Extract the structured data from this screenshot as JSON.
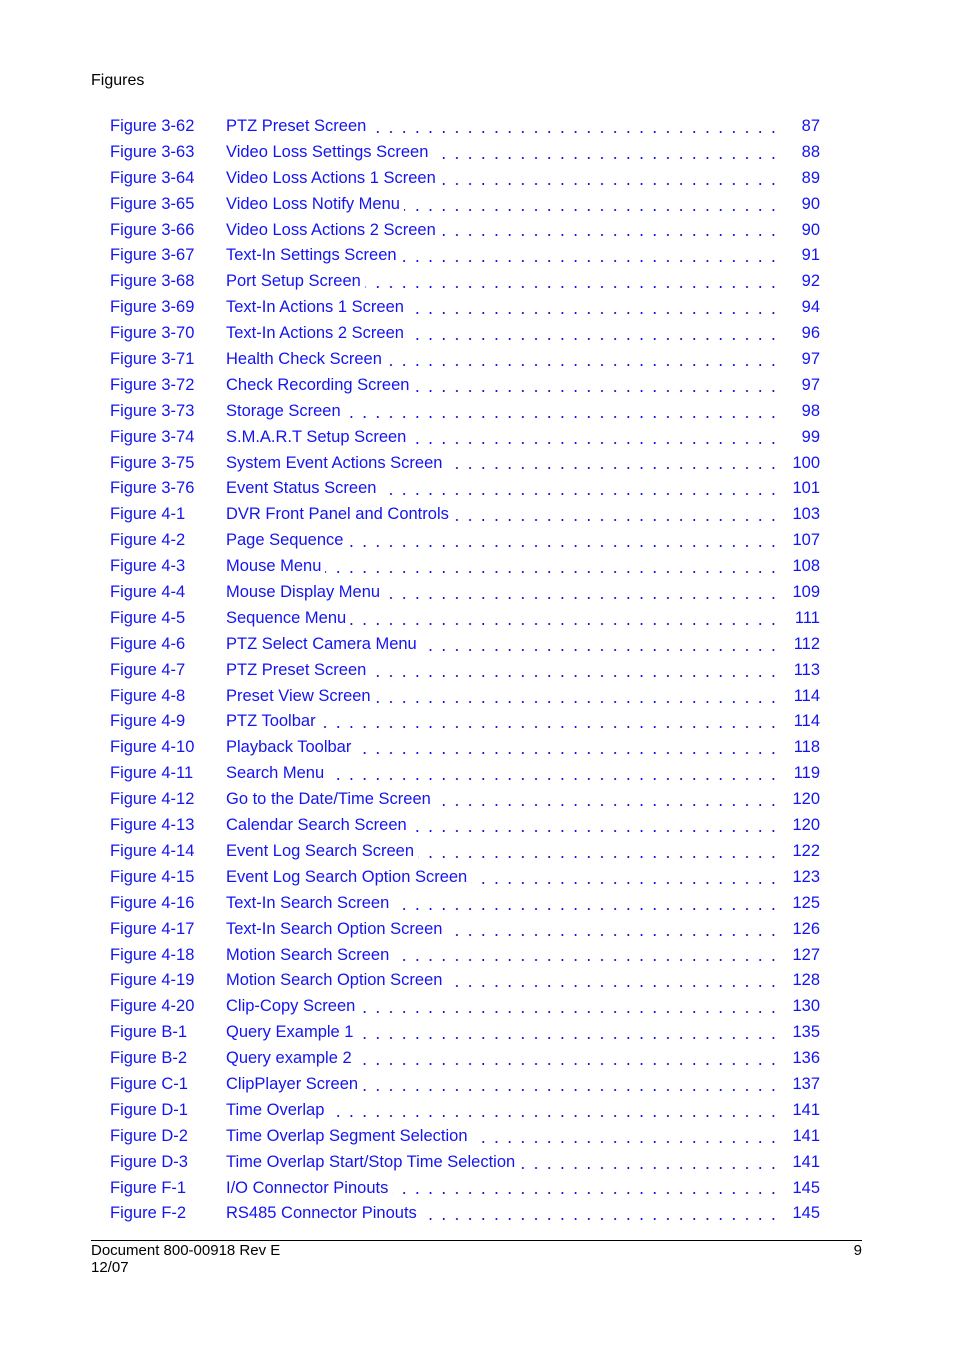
{
  "header": {
    "section": "Figures"
  },
  "entries": [
    {
      "figure": "Figure 3-62",
      "title": "PTZ Preset Screen",
      "page": "87"
    },
    {
      "figure": "Figure 3-63",
      "title": "Video Loss Settings Screen",
      "page": "88"
    },
    {
      "figure": "Figure 3-64",
      "title": "Video Loss Actions 1 Screen",
      "page": "89"
    },
    {
      "figure": "Figure 3-65",
      "title": "Video Loss Notify Menu",
      "page": "90"
    },
    {
      "figure": "Figure 3-66",
      "title": "Video Loss Actions 2 Screen",
      "page": "90"
    },
    {
      "figure": "Figure 3-67",
      "title": "Text-In Settings Screen",
      "page": "91"
    },
    {
      "figure": "Figure 3-68",
      "title": "Port Setup Screen",
      "page": "92"
    },
    {
      "figure": "Figure 3-69",
      "title": "Text-In Actions 1 Screen",
      "page": "94"
    },
    {
      "figure": "Figure 3-70",
      "title": "Text-In Actions 2 Screen",
      "page": "96"
    },
    {
      "figure": "Figure 3-71",
      "title": "Health Check Screen",
      "page": "97"
    },
    {
      "figure": "Figure 3-72",
      "title": "Check Recording Screen",
      "page": "97"
    },
    {
      "figure": "Figure 3-73",
      "title": "Storage Screen",
      "page": "98"
    },
    {
      "figure": "Figure 3-74",
      "title": "S.M.A.R.T Setup Screen",
      "page": "99"
    },
    {
      "figure": "Figure 3-75",
      "title": "System Event Actions Screen",
      "page": "100"
    },
    {
      "figure": "Figure 3-76",
      "title": "Event Status Screen",
      "page": "101"
    },
    {
      "figure": "Figure 4-1",
      "title": "DVR Front Panel and Controls",
      "page": "103"
    },
    {
      "figure": "Figure 4-2",
      "title": "Page Sequence",
      "page": "107"
    },
    {
      "figure": "Figure 4-3",
      "title": "Mouse Menu",
      "page": "108"
    },
    {
      "figure": "Figure 4-4",
      "title": "Mouse Display Menu",
      "page": "109"
    },
    {
      "figure": "Figure 4-5",
      "title": "Sequence Menu",
      "page": "111"
    },
    {
      "figure": "Figure 4-6",
      "title": "PTZ Select Camera Menu",
      "page": "112"
    },
    {
      "figure": "Figure 4-7",
      "title": "PTZ Preset Screen",
      "page": "113"
    },
    {
      "figure": "Figure 4-8",
      "title": "Preset View Screen",
      "page": "114"
    },
    {
      "figure": "Figure 4-9",
      "title": "PTZ Toolbar",
      "page": "114"
    },
    {
      "figure": "Figure 4-10",
      "title": "Playback Toolbar",
      "page": "118"
    },
    {
      "figure": "Figure 4-11",
      "title": "Search Menu",
      "page": "119"
    },
    {
      "figure": "Figure 4-12",
      "title": "Go to the Date/Time Screen",
      "page": "120"
    },
    {
      "figure": "Figure 4-13",
      "title": "Calendar Search Screen",
      "page": "120"
    },
    {
      "figure": "Figure 4-14",
      "title": "Event Log Search Screen",
      "page": "122"
    },
    {
      "figure": "Figure 4-15",
      "title": "Event Log Search Option Screen",
      "page": "123"
    },
    {
      "figure": "Figure 4-16",
      "title": "Text-In Search Screen",
      "page": "125"
    },
    {
      "figure": "Figure 4-17",
      "title": "Text-In Search Option Screen",
      "page": "126"
    },
    {
      "figure": "Figure 4-18",
      "title": "Motion Search Screen",
      "page": "127"
    },
    {
      "figure": "Figure 4-19",
      "title": "Motion Search Option Screen",
      "page": "128"
    },
    {
      "figure": "Figure 4-20",
      "title": "Clip-Copy Screen",
      "page": "130"
    },
    {
      "figure": "Figure B-1",
      "title": "Query Example 1",
      "page": "135"
    },
    {
      "figure": "Figure B-2",
      "title": "Query example 2",
      "page": "136"
    },
    {
      "figure": "Figure C-1",
      "title": "ClipPlayer Screen",
      "page": "137"
    },
    {
      "figure": "Figure D-1",
      "title": "Time Overlap",
      "page": "141"
    },
    {
      "figure": "Figure D-2",
      "title": "Time Overlap Segment Selection",
      "page": "141"
    },
    {
      "figure": "Figure D-3",
      "title": "Time Overlap Start/Stop Time Selection",
      "page": "141"
    },
    {
      "figure": "Figure F-1",
      "title": "I/O Connector Pinouts",
      "page": "145"
    },
    {
      "figure": "Figure F-2",
      "title": "RS485 Connector Pinouts",
      "page": "145"
    }
  ],
  "footer": {
    "document": "Document 800-00918 Rev E",
    "date": "12/07",
    "page_number": "9"
  },
  "colors": {
    "link": "#1414f0",
    "text": "#000000"
  }
}
